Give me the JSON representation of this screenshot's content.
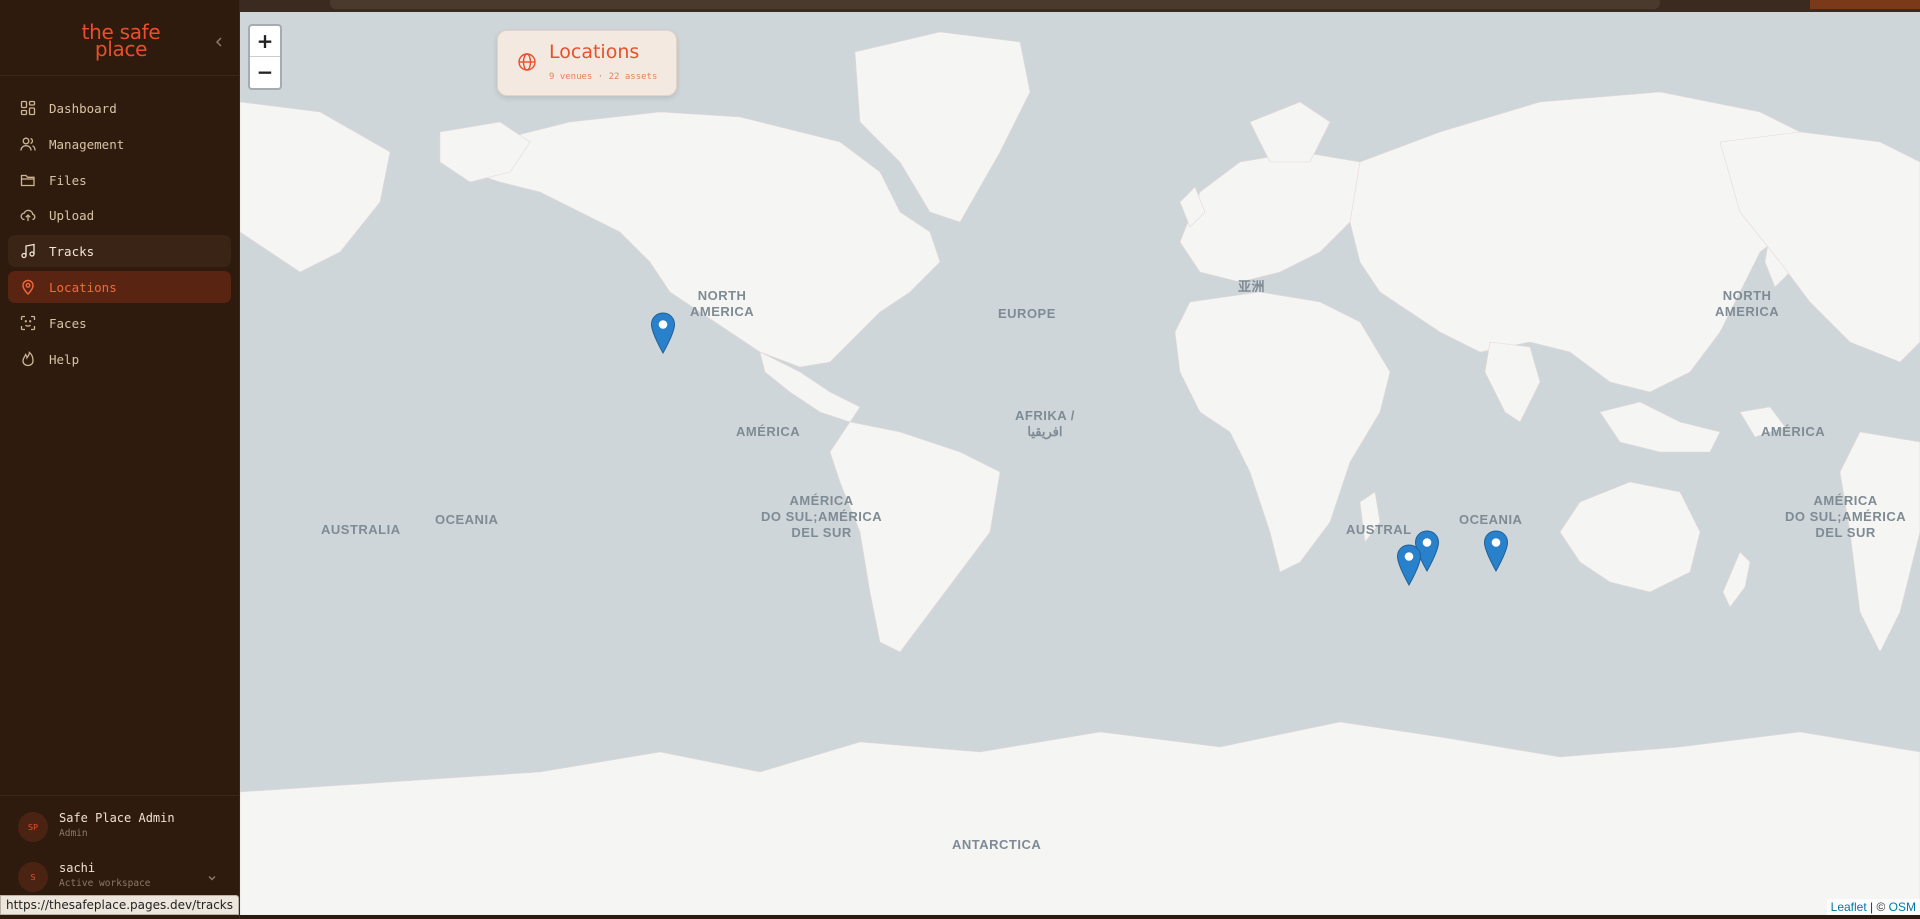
{
  "app": {
    "logo_line1": "the safe",
    "logo_line2": "place"
  },
  "sidebar": {
    "items": [
      {
        "label": "Dashboard",
        "icon": "dashboard-icon"
      },
      {
        "label": "Management",
        "icon": "users-icon"
      },
      {
        "label": "Files",
        "icon": "folder-icon"
      },
      {
        "label": "Upload",
        "icon": "upload-cloud-icon"
      },
      {
        "label": "Tracks",
        "icon": "music-icon",
        "state": "hover"
      },
      {
        "label": "Locations",
        "icon": "map-pin-icon",
        "state": "active"
      },
      {
        "label": "Faces",
        "icon": "face-scan-icon"
      },
      {
        "label": "Help",
        "icon": "flame-icon"
      }
    ]
  },
  "user": {
    "avatar": "SP",
    "name": "Safe Place Admin",
    "role": "Admin"
  },
  "workspace": {
    "avatar": "S",
    "name": "sachi",
    "subtitle": "Active workspace"
  },
  "locations_card": {
    "title": "Locations",
    "subtitle": "9 venues · 22 assets"
  },
  "zoom": {
    "in": "+",
    "out": "−"
  },
  "map_labels": {
    "north_america_1": "NORTH\nAMERICA",
    "north_america_2": "NORTH\nAMERICA",
    "europe": "EUROPE",
    "asia": "亚洲",
    "america_1": "AMÉRICA",
    "america_2": "AMÉRICA",
    "africa": "AFRIKA /\nافريقيا",
    "south_america_1": "AMÉRICA\nDO SUL;AMÉRICA\nDEL SUR",
    "south_america_2": "AMÉRICA\nDO SUL;AMÉRICA\nDEL SUR",
    "australia_1": "AUSTRALIA",
    "australia_2": "AUSTRAL",
    "oceania_1": "OCEANIA",
    "oceania_2": "OCEANIA",
    "antarctica": "ANTARCTICA"
  },
  "attribution": {
    "leaflet": "Leaflet",
    "sep": " | © ",
    "osm": "OSM"
  },
  "status_url": "https://thesafeplace.pages.dev/tracks",
  "colors": {
    "accent": "#e8502a",
    "sidebar_bg": "#2e1b0e",
    "active_bg": "#5a2412",
    "marker": "#2a81cb"
  }
}
